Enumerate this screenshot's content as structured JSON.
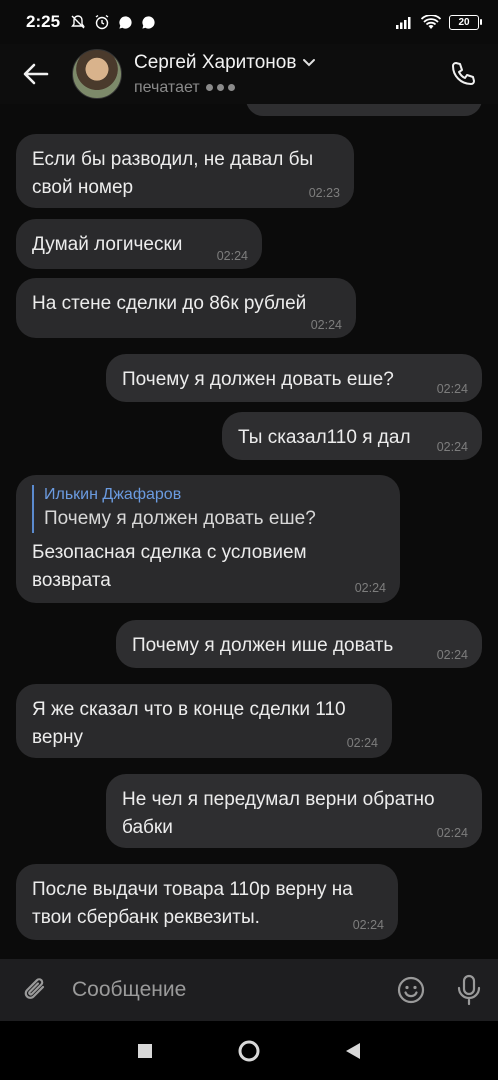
{
  "status_bar": {
    "time": "2:25",
    "battery": "20"
  },
  "header": {
    "name": "Сергей Харитонов",
    "status": "печатает"
  },
  "messages": [
    {
      "dir": "in",
      "lines": [
        "Если бы разводил, не давал бы",
        "свой номер"
      ],
      "time": "02:23"
    },
    {
      "dir": "in",
      "lines": [
        "Думай логически"
      ],
      "time": "02:24"
    },
    {
      "dir": "in",
      "lines": [
        "На стене сделки до 86к рублей"
      ],
      "time": "02:24"
    },
    {
      "dir": "out",
      "lines": [
        "Почему я должен довать еше?"
      ],
      "time": "02:24"
    },
    {
      "dir": "out",
      "lines": [
        "Ты сказал110 я дал"
      ],
      "time": "02:24"
    },
    {
      "dir": "in",
      "reply_author": "Илькин Джафаров",
      "reply_text": "Почему я должен довать еше?",
      "lines": [
        "Безопасная сделка с условием",
        "возврата"
      ],
      "time": "02:24"
    },
    {
      "dir": "out",
      "lines": [
        "Почему я должен ише довать"
      ],
      "time": "02:24"
    },
    {
      "dir": "in",
      "lines": [
        "Я же сказал что в конце сделки 110",
        "верну"
      ],
      "time": "02:24"
    },
    {
      "dir": "out",
      "lines": [
        "Не чел я передумал верни обратно",
        "бабки"
      ],
      "time": "02:24"
    },
    {
      "dir": "in",
      "lines": [
        "После выдачи товара 110р верну на",
        "твои сбербанк реквезиты."
      ],
      "time": "02:24"
    }
  ],
  "composer": {
    "placeholder": "Сообщение"
  },
  "colors": {
    "background": "#0b0b0b",
    "bubble": "#2a2a2c",
    "reply_accent": "#6b9be0",
    "time_text": "#7d7d7d"
  }
}
